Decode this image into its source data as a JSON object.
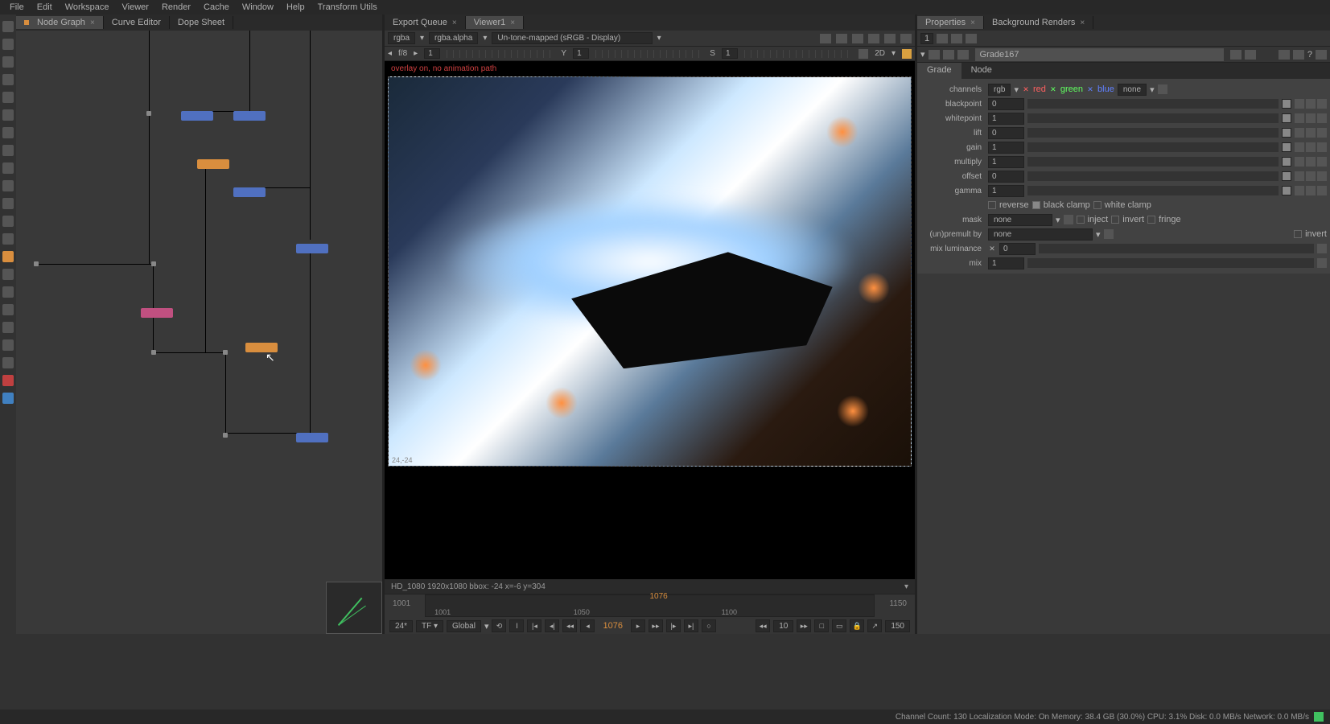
{
  "menu": [
    "File",
    "Edit",
    "Workspace",
    "Viewer",
    "Render",
    "Cache",
    "Window",
    "Help",
    "Transform Utils"
  ],
  "left_tabs": [
    {
      "label": "Node Graph",
      "active": true
    },
    {
      "label": "Curve Editor",
      "active": false
    },
    {
      "label": "Dope Sheet",
      "active": false
    }
  ],
  "center_tabs": [
    {
      "label": "Export Queue",
      "active": false
    },
    {
      "label": "Viewer1",
      "active": true
    }
  ],
  "right_tabs": [
    {
      "label": "Properties",
      "active": true
    },
    {
      "label": "Background Renders",
      "active": false
    }
  ],
  "viewer_toolbar": {
    "channel": "rgba",
    "alpha": "rgba.alpha",
    "lut": "Un-tone-mapped (sRGB - Display)"
  },
  "viewer_info": {
    "fstop_label": "f/8",
    "fstop_val": "1",
    "y_label": "Y",
    "y_val": "1",
    "s_label": "S",
    "s_val": "1",
    "dim": "2D"
  },
  "overlay_msg": "overlay on, no animation path",
  "viewer_coord": "24,-24",
  "viewer_status": "HD_1080 1920x1080  bbox: -24   x=-6 y=304",
  "timeline": {
    "start": "1001",
    "end": "1150",
    "ticks": [
      "1001",
      "1050",
      "1100"
    ],
    "current": "1076",
    "fps": "24*",
    "tf": "TF ▾",
    "mode": "Global",
    "skip": "10",
    "range_end": "150"
  },
  "prop_header_num": "1",
  "node_name": "Grade167",
  "sub_tabs": [
    "Grade",
    "Node"
  ],
  "channels": {
    "label": "channels",
    "val": "rgb",
    "r": "red",
    "g": "green",
    "b": "blue",
    "extra": "none"
  },
  "rows": [
    {
      "label": "blackpoint",
      "val": "0"
    },
    {
      "label": "whitepoint",
      "val": "1"
    },
    {
      "label": "lift",
      "val": "0"
    },
    {
      "label": "gain",
      "val": "1"
    },
    {
      "label": "multiply",
      "val": "1"
    },
    {
      "label": "offset",
      "val": "0"
    },
    {
      "label": "gamma",
      "val": "1"
    }
  ],
  "clamp": {
    "reverse": "reverse",
    "black": "black clamp",
    "white": "white clamp"
  },
  "mask": {
    "label": "mask",
    "val": "none",
    "inject": "inject",
    "invert": "invert",
    "fringe": "fringe"
  },
  "unpremult": {
    "label": "(un)premult by",
    "val": "none",
    "invert": "invert"
  },
  "mixlum": {
    "label": "mix luminance",
    "val": "0"
  },
  "mix": {
    "label": "mix",
    "val": "1"
  },
  "statusbar": "Channel Count: 130 Localization Mode: On Memory: 38.4 GB (30.0%) CPU: 3.1% Disk: 0.0 MB/s Network: 0.0 MB/s"
}
